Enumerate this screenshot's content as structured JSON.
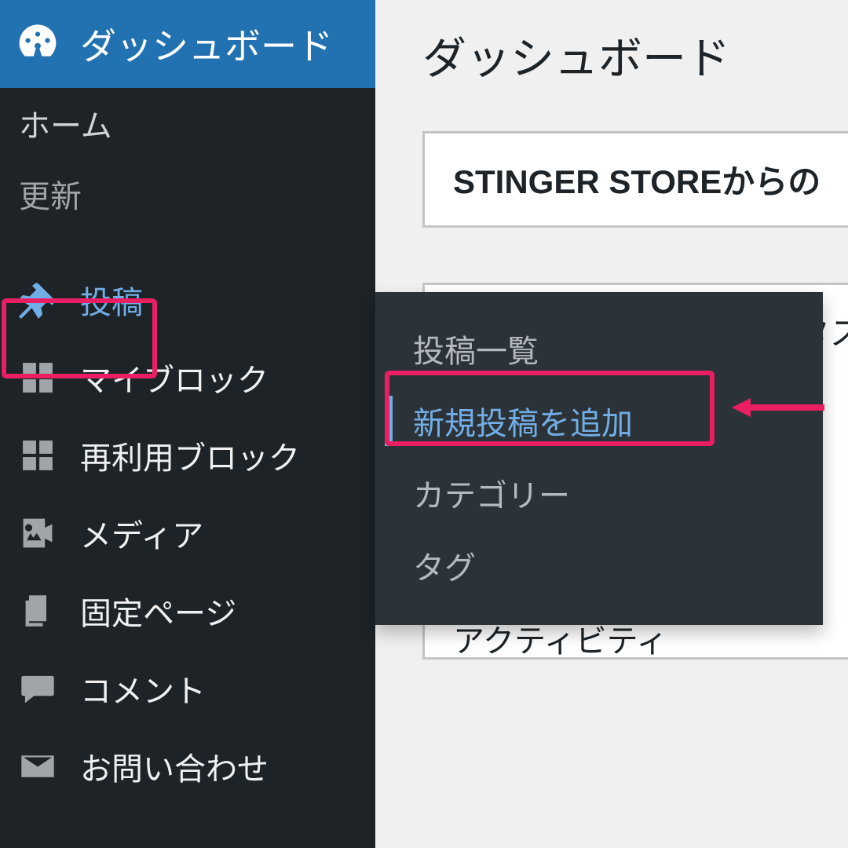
{
  "page_title": "ダッシュボード",
  "notice_panel": "STINGER STOREからの",
  "activity_label_tail": "タス",
  "activity_label": "アクティビティ",
  "sidebar": {
    "dashboard": "ダッシュボード",
    "home": "ホーム",
    "updates": "更新",
    "posts": "投稿",
    "my_block": "マイブロック",
    "reusable_block": "再利用ブロック",
    "media": "メディア",
    "pages": "固定ページ",
    "comments": "コメント",
    "contact": "お問い合わせ"
  },
  "flyout": {
    "list": "投稿一覧",
    "new": "新規投稿を追加",
    "categories": "カテゴリー",
    "tags": "タグ"
  },
  "annotation": {
    "highlight_color": "#e91e63"
  }
}
